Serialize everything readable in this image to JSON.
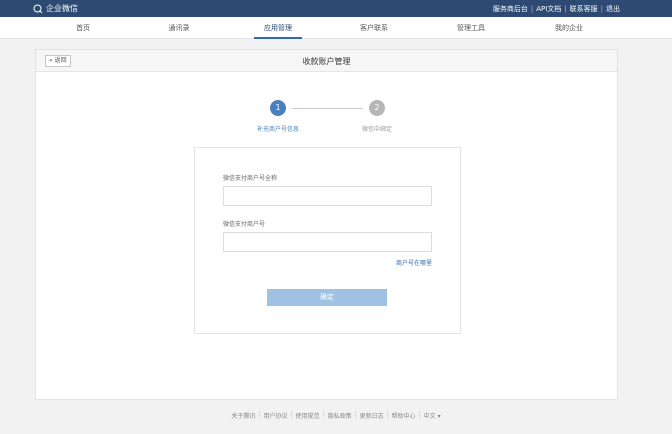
{
  "app": {
    "name": "企业微信",
    "top_links": [
      "服务商后台",
      "API文档",
      "联系客服",
      "退出"
    ]
  },
  "nav": {
    "items": [
      "首页",
      "通讯录",
      "应用管理",
      "客户联系",
      "管理工具",
      "我的企业"
    ],
    "active": "应用管理"
  },
  "page": {
    "back_label": "« 返回",
    "title": "收款账户管理"
  },
  "steps": [
    {
      "number": "1",
      "label": "补充商户号信息",
      "state": "active"
    },
    {
      "number": "2",
      "label": "微信中绑定",
      "state": "inactive"
    }
  ],
  "form": {
    "name_label": "微信支付商户号全称",
    "name_value": "",
    "id_label": "微信支付商户号",
    "id_value": "",
    "help_link": "商户号在哪里",
    "submit_label": "确定"
  },
  "footer": {
    "links": [
      "关于腾讯",
      "用户协议",
      "使用规范",
      "隐私政策",
      "更新日志",
      "帮助中心",
      "中文 ▾"
    ]
  },
  "colors": {
    "brand": "#2d4a73",
    "accent": "#4a7fc0",
    "button_disabled": "#9fc1e3"
  }
}
